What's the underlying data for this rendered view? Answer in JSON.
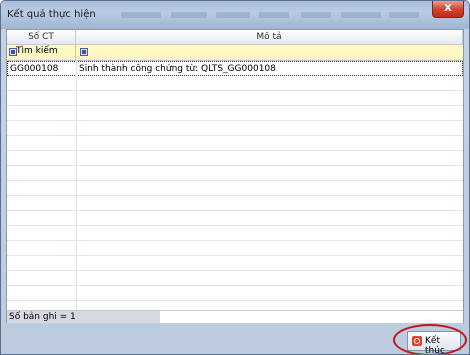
{
  "window": {
    "title": "Kết quả thực hiện",
    "close_label": "X"
  },
  "grid": {
    "columns": [
      "Số CT",
      "Mô tả"
    ],
    "filter": {
      "search_label": "Tìm kiếm"
    },
    "rows": [
      {
        "so_ct": "GG000108",
        "mo_ta": "Sinh thành công chứng từ: QLTS_GG000108"
      }
    ],
    "record_count_label": "Số bản ghi = 1"
  },
  "actions": {
    "finish_label": "Kết thúc"
  },
  "colors": {
    "title_bar": "#b9cbe4",
    "filter_row": "#fdf7c4",
    "close_button": "#d2452f",
    "highlight_ring": "#c4171b"
  },
  "icons": [
    "close-icon",
    "filter-icon",
    "finish-icon"
  ]
}
